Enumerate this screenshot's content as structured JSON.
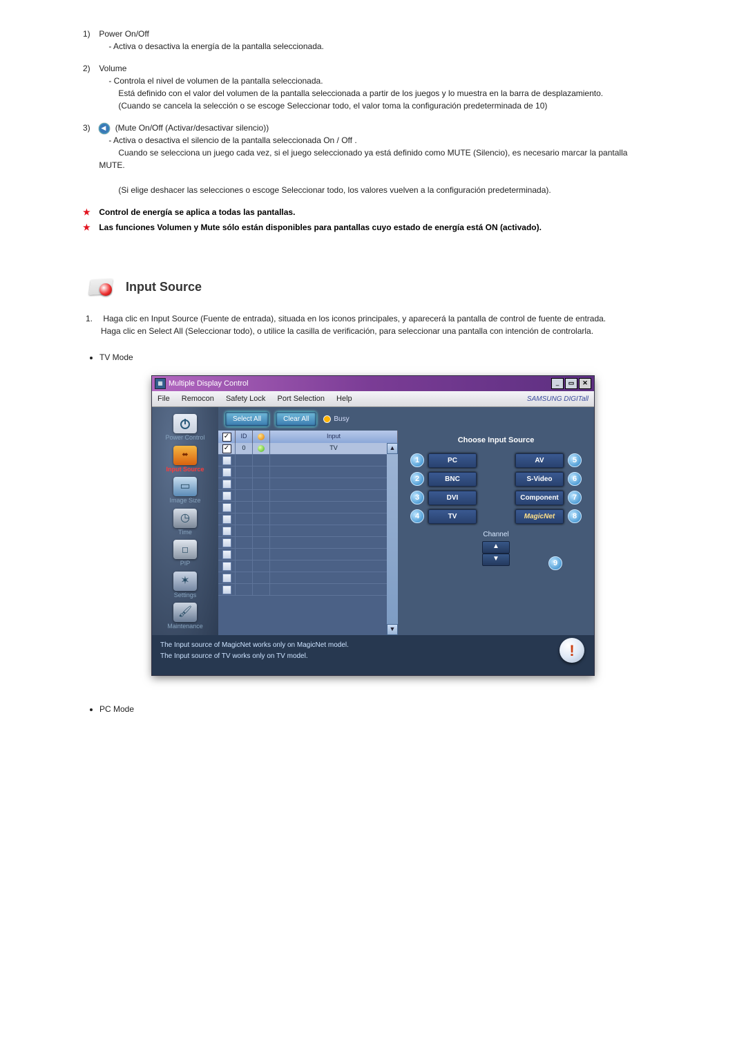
{
  "items": {
    "1": {
      "num": "1)",
      "title": "Power On/Off",
      "lines": [
        "- Activa o desactiva la energía de la pantalla seleccionada."
      ]
    },
    "2": {
      "num": "2)",
      "title": "Volume",
      "lines": [
        "- Controla el nivel de volumen de la pantalla seleccionada.",
        "Está definido con el valor del volumen de la pantalla seleccionada a partir de los juegos y lo muestra en la barra de desplazamiento.",
        "(Cuando se cancela la selección o se escoge Seleccionar todo, el valor toma la configuración predeterminada de 10)"
      ]
    },
    "3": {
      "num": "3)",
      "label_after_icon": "(Mute On/Off (Activar/desactivar silencio))",
      "lines": [
        "- Activa o desactiva el silencio de la pantalla seleccionada On / Off .",
        "Cuando se selecciona un juego cada vez, si el juego seleccionado ya está definido como MUTE (Silencio), es necesario marcar la pantalla MUTE.",
        "",
        "(Si elige deshacer las selecciones o escoge Seleccionar todo, los valores vuelven a la configuración predeterminada)."
      ]
    }
  },
  "notes": {
    "n1": "Control de energía se aplica a todas las pantallas.",
    "n2": "Las funciones Volumen y Mute sólo están disponibles para pantallas cuyo estado de energía está ON (activado)."
  },
  "section_heading": "Input Source",
  "intro": {
    "num": "1.",
    "p1": "Haga clic en Input Source (Fuente de entrada), situada en los iconos principales, y aparecerá la pantalla de control de fuente de entrada.",
    "p2": "Haga clic en Select All (Seleccionar todo), o utilice la casilla de verificación, para seleccionar una pantalla con intención de controlarla."
  },
  "bullet_tv": "TV Mode",
  "bullet_pc": "PC Mode",
  "app": {
    "title": "Multiple Display Control",
    "menus": [
      "File",
      "Remocon",
      "Safety Lock",
      "Port Selection",
      "Help"
    ],
    "brand": "SAMSUNG DIGITall",
    "toolbar": {
      "select_all": "Select All",
      "clear_all": "Clear All",
      "busy": "Busy"
    },
    "sidebar": {
      "items": [
        {
          "label": "Power Control"
        },
        {
          "label": "Input Source"
        },
        {
          "label": "Image Size"
        },
        {
          "label": "Time"
        },
        {
          "label": "PIP"
        },
        {
          "label": "Settings"
        },
        {
          "label": "Maintenance"
        }
      ]
    },
    "grid": {
      "headers": {
        "chk": "",
        "id": "ID",
        "status": "",
        "input": "Input"
      },
      "row_on": {
        "id": "0",
        "input": "TV"
      }
    },
    "right": {
      "choose": "Choose Input Source",
      "src": {
        "pc": "PC",
        "bnc": "BNC",
        "dvi": "DVI",
        "tv": "TV",
        "av": "AV",
        "svideo": "S-Video",
        "component": "Component",
        "magic": "MagicNet"
      },
      "channel": "Channel"
    },
    "footer": {
      "l1": "The Input source of MagicNet works only on MagicNet model.",
      "l2": "The Input source of TV works only on TV  model."
    },
    "callouts": {
      "c1": "1",
      "c2": "2",
      "c3": "3",
      "c4": "4",
      "c5": "5",
      "c6": "6",
      "c7": "7",
      "c8": "8",
      "c9": "9"
    },
    "glyphs": {
      "check": "✓",
      "up": "▲",
      "down": "▼",
      "close": "✕",
      "min": "_",
      "max": "▭"
    }
  }
}
